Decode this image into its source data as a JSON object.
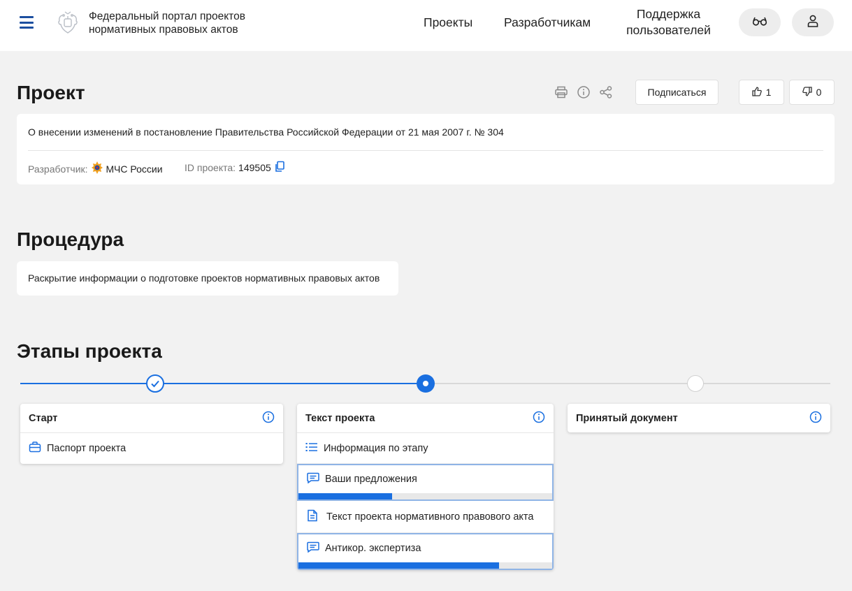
{
  "header": {
    "portal_title_line1": "Федеральный портал проектов",
    "portal_title_line2": "нормативных правовых актов",
    "nav": {
      "projects": "Проекты",
      "developers": "Разработчикам",
      "support_line1": "Поддержка",
      "support_line2": "пользователей"
    }
  },
  "project": {
    "heading": "Проект",
    "subscribe_label": "Подписаться",
    "likes": "1",
    "dislikes": "0",
    "description": "О внесении изменений в постановление Правительства Российской Федерации от 21 мая 2007 г. № 304",
    "developer_label": "Разработчик:",
    "developer_value": "МЧС России",
    "id_label": "ID проекта:",
    "id_value": "149505"
  },
  "procedure": {
    "heading": "Процедура",
    "text": "Раскрытие информации о подготовке проектов нормативных правовых актов"
  },
  "stages": {
    "heading": "Этапы проекта",
    "items": [
      {
        "title": "Старт",
        "status": "done",
        "rows": [
          {
            "label": "Паспорт проекта",
            "icon": "briefcase-icon"
          }
        ]
      },
      {
        "title": "Текст проекта",
        "status": "current",
        "rows": [
          {
            "label": "Информация по этапу",
            "icon": "list-icon"
          },
          {
            "label": "Ваши предложения",
            "icon": "comment-icon",
            "progress": 0.37
          },
          {
            "label": "Текст проекта нормативного правового акта",
            "icon": "document-icon"
          },
          {
            "label": "Антикор. экспертиза",
            "icon": "comment-icon",
            "progress": 0.79
          }
        ]
      },
      {
        "title": "Принятый документ",
        "status": "pending",
        "rows": []
      }
    ]
  },
  "colors": {
    "accent": "#1a6fe0",
    "nav_blue": "#1c4fa0",
    "page_bg": "#f2f2f2",
    "selected_border": "#8fb4e6"
  }
}
